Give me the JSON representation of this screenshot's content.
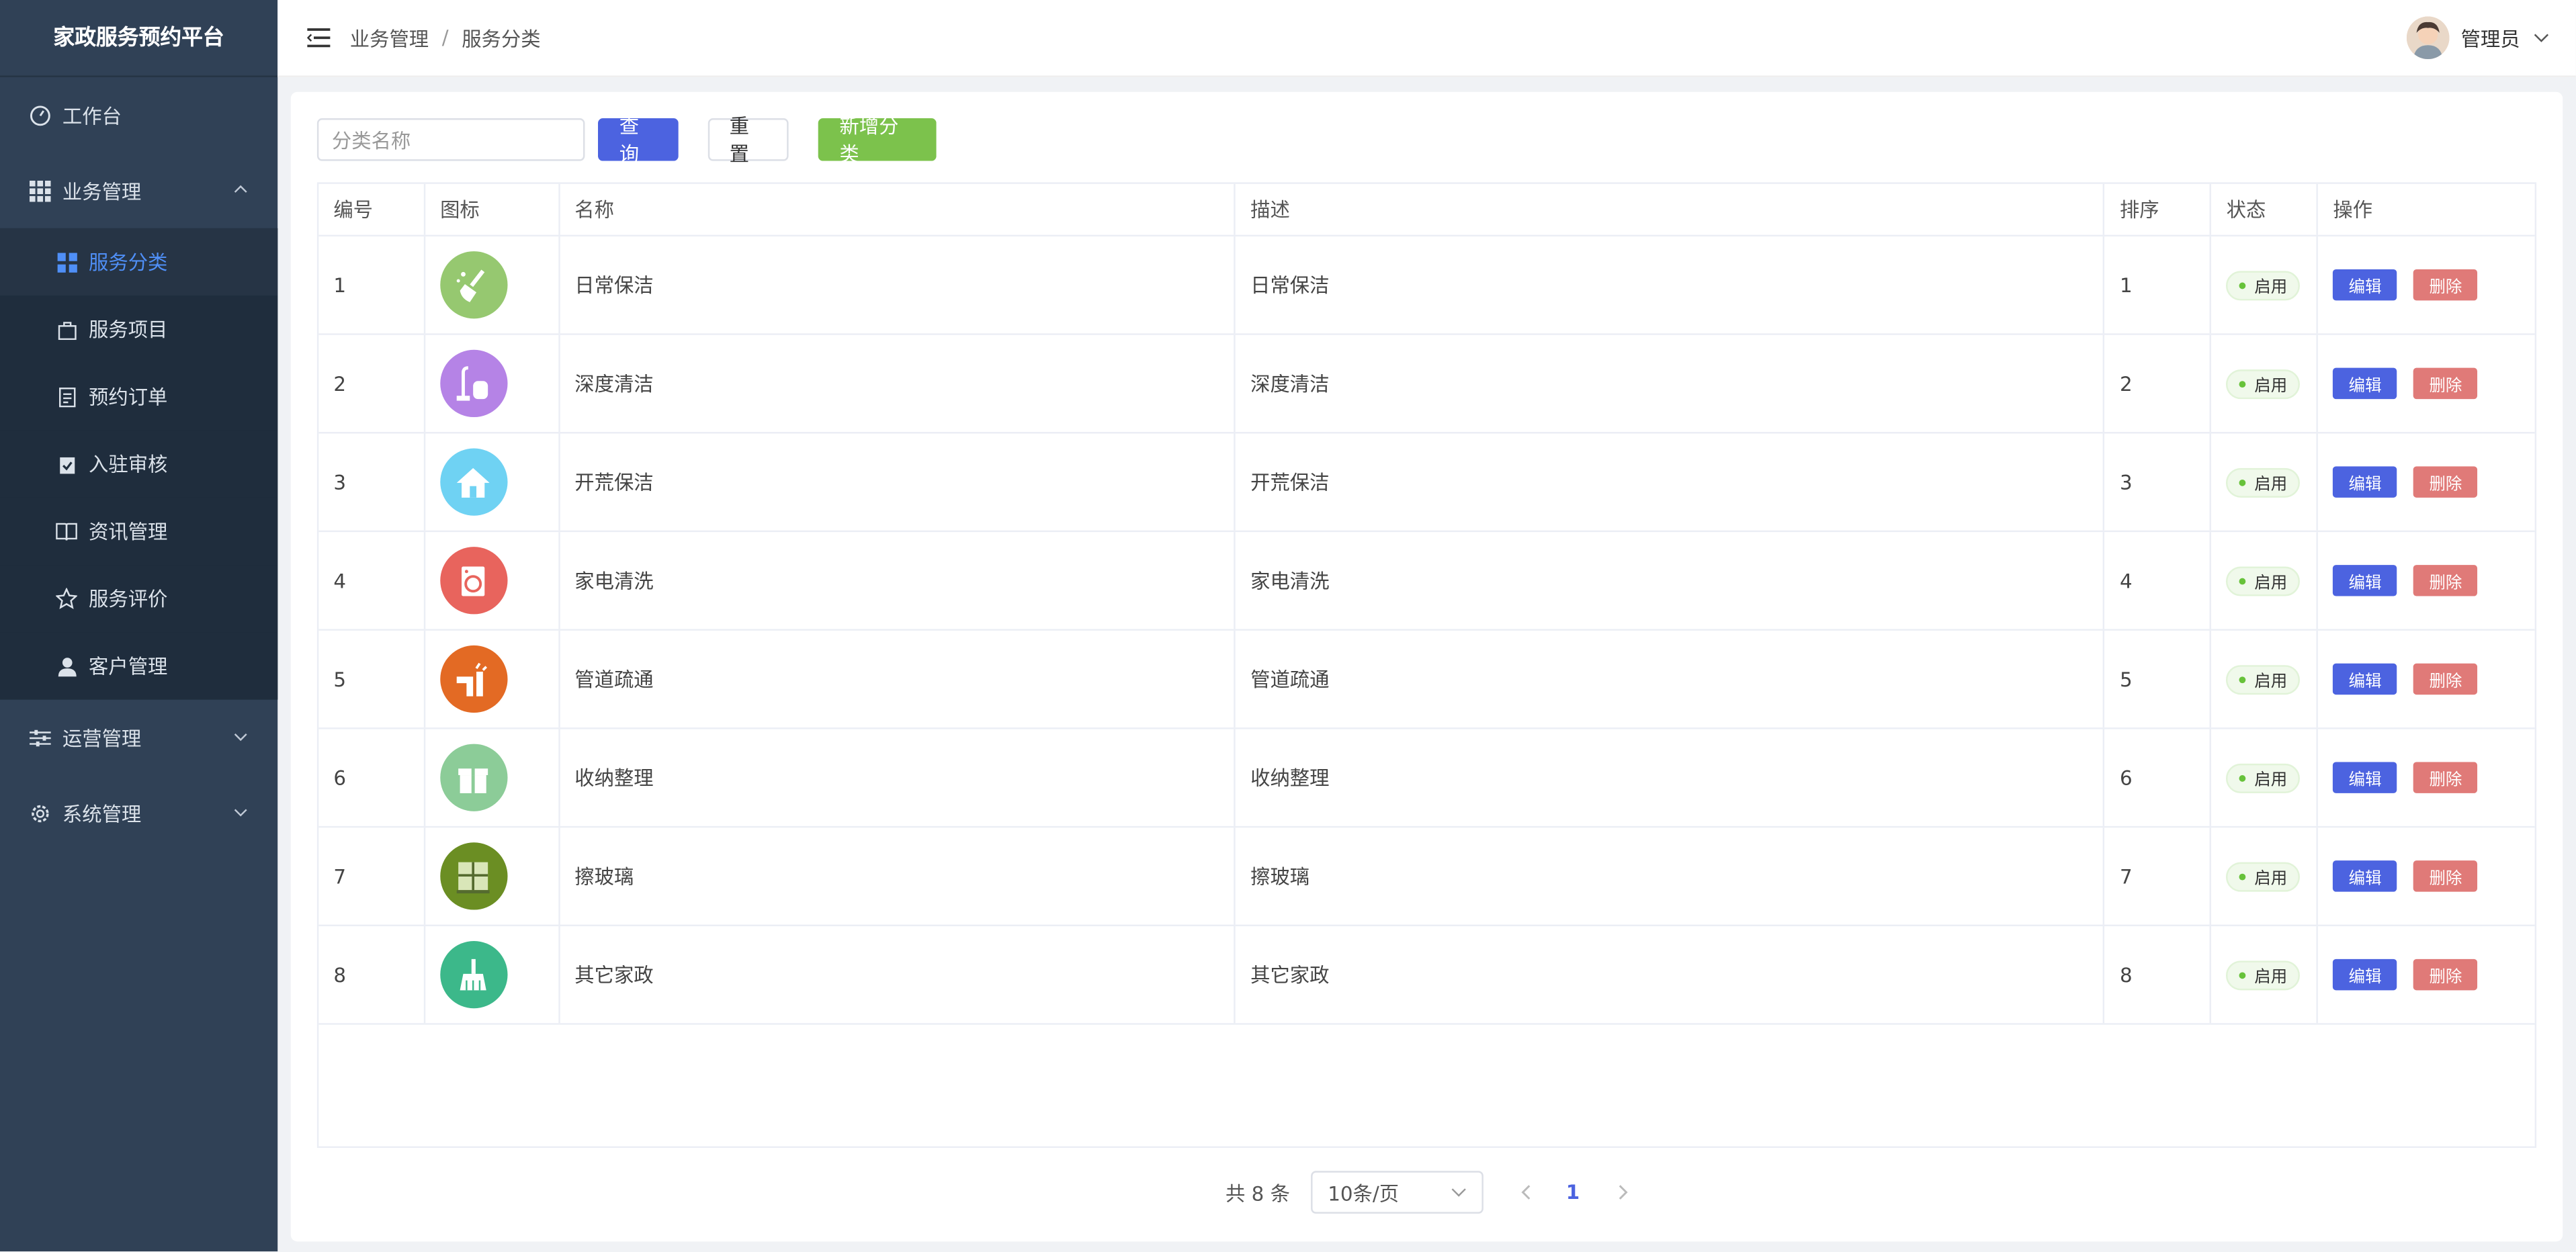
{
  "brand": "家政服务预约平台",
  "sidebar": {
    "items": [
      {
        "label": "工作台"
      },
      {
        "label": "业务管理"
      },
      {
        "label": "运营管理"
      },
      {
        "label": "系统管理"
      }
    ],
    "sub_items": [
      {
        "label": "服务分类"
      },
      {
        "label": "服务项目"
      },
      {
        "label": "预约订单"
      },
      {
        "label": "入驻审核"
      },
      {
        "label": "资讯管理"
      },
      {
        "label": "服务评价"
      },
      {
        "label": "客户管理"
      }
    ]
  },
  "header": {
    "breadcrumb": [
      "业务管理",
      "服务分类"
    ],
    "breadcrumb_sep": "/",
    "user": "管理员"
  },
  "toolbar": {
    "search_placeholder": "分类名称",
    "query": "查询",
    "reset": "重置",
    "add": "新增分类"
  },
  "table": {
    "headers": [
      "编号",
      "图标",
      "名称",
      "描述",
      "排序",
      "状态",
      "操作"
    ],
    "rows": [
      {
        "id": "1",
        "name": "日常保洁",
        "desc": "日常保洁",
        "sort": "1",
        "status": "启用",
        "icon": "broom-icon",
        "color": "#96c870"
      },
      {
        "id": "2",
        "name": "深度清洁",
        "desc": "深度清洁",
        "sort": "2",
        "status": "启用",
        "icon": "vacuum-icon",
        "color": "#b583e6"
      },
      {
        "id": "3",
        "name": "开荒保洁",
        "desc": "开荒保洁",
        "sort": "3",
        "status": "启用",
        "icon": "house-icon",
        "color": "#6fd2f3"
      },
      {
        "id": "4",
        "name": "家电清洗",
        "desc": "家电清洗",
        "sort": "4",
        "status": "启用",
        "icon": "washer-icon",
        "color": "#e8645d"
      },
      {
        "id": "5",
        "name": "管道疏通",
        "desc": "管道疏通",
        "sort": "5",
        "status": "启用",
        "icon": "pipe-icon",
        "color": "#e36a24"
      },
      {
        "id": "6",
        "name": "收纳整理",
        "desc": "收纳整理",
        "sort": "6",
        "status": "启用",
        "icon": "box-icon",
        "color": "#8ccc98"
      },
      {
        "id": "7",
        "name": "擦玻璃",
        "desc": "擦玻璃",
        "sort": "7",
        "status": "启用",
        "icon": "window-icon",
        "color": "#6b8e23"
      },
      {
        "id": "8",
        "name": "其它家政",
        "desc": "其它家政",
        "sort": "8",
        "status": "启用",
        "icon": "brush-icon",
        "color": "#3cb88a"
      }
    ],
    "edit": "编辑",
    "delete": "删除"
  },
  "pagination": {
    "total": "共 8 条",
    "page_size": "10条/页",
    "current": "1"
  }
}
